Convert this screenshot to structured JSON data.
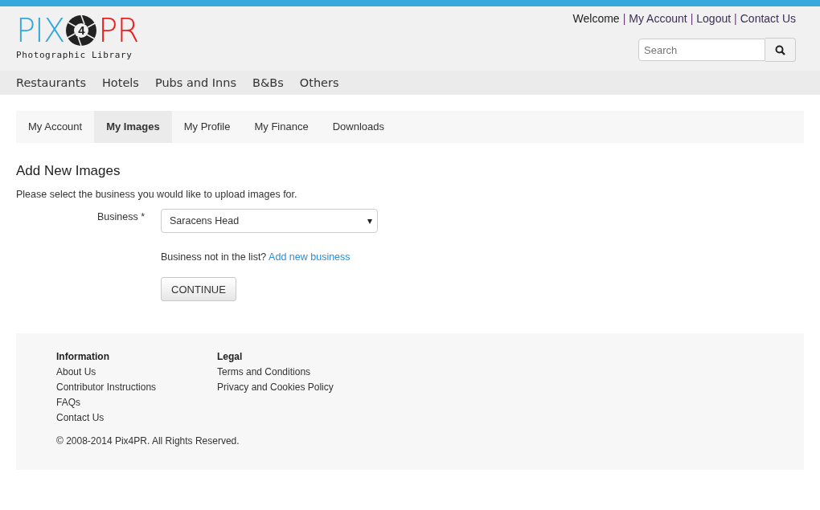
{
  "logo": {
    "left": "PIX",
    "badge": "4",
    "right": "PR",
    "tagline": "Photographic Library"
  },
  "top_links": [
    {
      "kind": "text",
      "text": "Welcome"
    },
    {
      "kind": "separator",
      "text": "|"
    },
    {
      "kind": "link",
      "text": "My Account"
    },
    {
      "kind": "separator",
      "text": "|"
    },
    {
      "kind": "link",
      "text": "Logout"
    },
    {
      "kind": "separator",
      "text": "|"
    },
    {
      "kind": "link",
      "text": "Contact Us"
    }
  ],
  "search": {
    "placeholder": "Search"
  },
  "categories": [
    "Restaurants",
    "Hotels",
    "Pubs and Inns",
    "B&Bs",
    "Others"
  ],
  "tabs": [
    {
      "label": "My Account",
      "selected": false
    },
    {
      "label": "My Images",
      "selected": true
    },
    {
      "label": "My Profile",
      "selected": false
    },
    {
      "label": "My Finance",
      "selected": false
    },
    {
      "label": "Downloads",
      "selected": false
    }
  ],
  "form": {
    "title": "Add New Images",
    "intro": "Please select the business you would like to upload images for.",
    "field_label": "Business *",
    "field_value": "Saracens Head",
    "caret": "▾",
    "hint": "Business not in the list?",
    "hint_link": "Add new business",
    "button": "CONTINUE"
  },
  "footer": {
    "columns": [
      {
        "heading": "Information",
        "links": [
          "About Us",
          "Contributor Instructions",
          "FAQs",
          "Contact Us"
        ]
      },
      {
        "heading": "Legal",
        "links": [
          "Terms and Conditions",
          "Privacy and Cookies Policy"
        ]
      }
    ],
    "copyright": "© 2008-2014 Pix4PR. All Rights Reserved."
  }
}
